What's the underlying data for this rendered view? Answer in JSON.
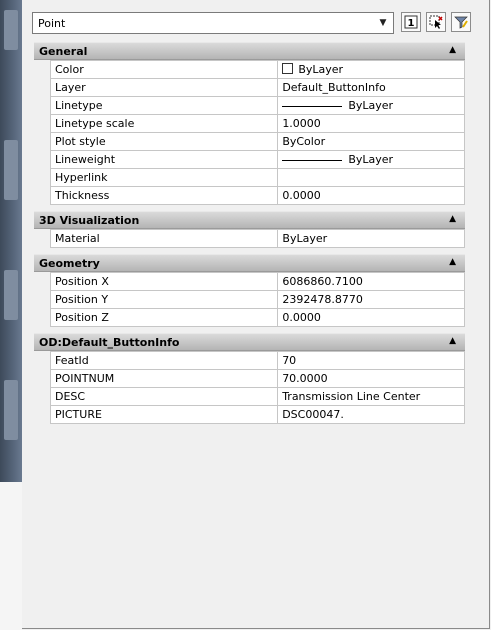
{
  "toolbar": {
    "selected_object": "Point",
    "quick_select_label": "1"
  },
  "sections": {
    "general": {
      "title": "General",
      "rows": [
        {
          "name": "Color",
          "value": "ByLayer"
        },
        {
          "name": "Layer",
          "value": "Default_ButtonInfo"
        },
        {
          "name": "Linetype",
          "value": "ByLayer"
        },
        {
          "name": "Linetype scale",
          "value": "1.0000"
        },
        {
          "name": "Plot style",
          "value": "ByColor"
        },
        {
          "name": "Lineweight",
          "value": "ByLayer"
        },
        {
          "name": "Hyperlink",
          "value": ""
        },
        {
          "name": "Thickness",
          "value": "0.0000"
        }
      ]
    },
    "visualization": {
      "title": "3D Visualization",
      "rows": [
        {
          "name": "Material",
          "value": "ByLayer"
        }
      ]
    },
    "geometry": {
      "title": "Geometry",
      "rows": [
        {
          "name": "Position X",
          "value": "6086860.7100"
        },
        {
          "name": "Position Y",
          "value": "2392478.8770"
        },
        {
          "name": "Position Z",
          "value": "0.0000"
        }
      ]
    },
    "od": {
      "title": "OD:Default_ButtonInfo",
      "rows": [
        {
          "name": "FeatId",
          "value": "70"
        },
        {
          "name": "POINTNUM",
          "value": "70.0000"
        },
        {
          "name": "DESC",
          "value": "Transmission Line Center"
        },
        {
          "name": "PICTURE",
          "value": "DSC00047."
        }
      ]
    }
  },
  "icons": {
    "collapse": "collapse-icon",
    "dropdown": "chevron-down-icon",
    "quick_select": "quick-select-icon",
    "select_objects": "select-objects-icon",
    "filter": "filter-icon"
  }
}
